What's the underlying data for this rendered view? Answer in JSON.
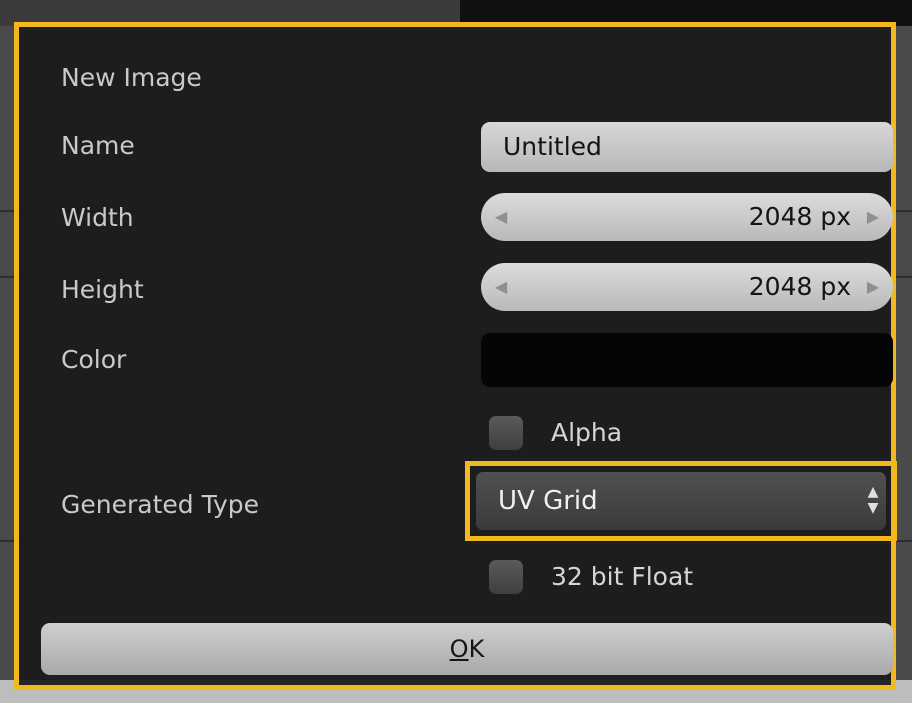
{
  "dialog": {
    "title": "New Image",
    "name_label": "Name",
    "name_value": "Untitled",
    "width_label": "Width",
    "width_value": "2048 px",
    "height_label": "Height",
    "height_value": "2048 px",
    "color_label": "Color",
    "color_value": "#050505",
    "alpha_label": "Alpha",
    "alpha_checked": false,
    "generated_type_label": "Generated Type",
    "generated_type_value": "UV Grid",
    "float_label": "32 bit Float",
    "float_checked": false,
    "ok_label_underlined": "O",
    "ok_label_rest": "K"
  },
  "colors": {
    "highlight": "#f2b81d",
    "popup_bg": "#1a1a1a"
  },
  "icons": {
    "decrement": "triangle-left",
    "increment": "triangle-right",
    "select_arrows": "up-down-arrows"
  }
}
